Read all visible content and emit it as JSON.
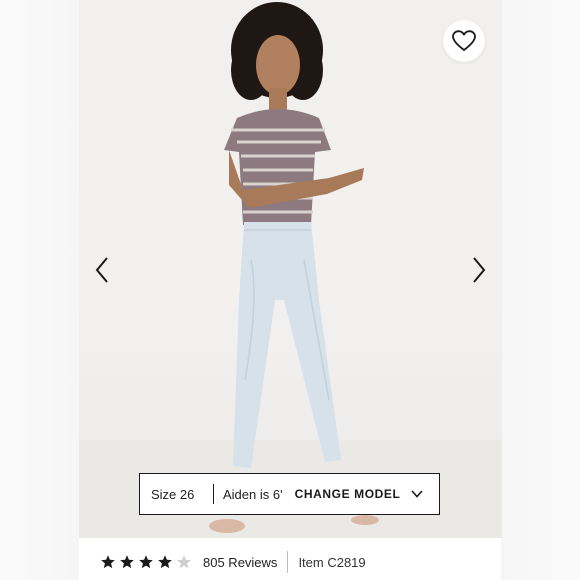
{
  "icons": {
    "favorite": "heart-outline-icon",
    "prev": "chevron-left-icon",
    "next": "chevron-right-icon",
    "dropdown": "chevron-down-icon",
    "rating": "star-icon"
  },
  "model_bar": {
    "size_label": "Size 26",
    "model_label": "Aiden is 6'",
    "change_label": "CHANGE MODEL"
  },
  "product_info": {
    "rating": 4,
    "rating_max": 5,
    "reviews_label": "805 Reviews",
    "item_label": "Item C2819"
  },
  "colors": {
    "star_filled": "#1a1a1a",
    "star_empty": "#cfcfcf",
    "border": "#1a1a1a"
  }
}
